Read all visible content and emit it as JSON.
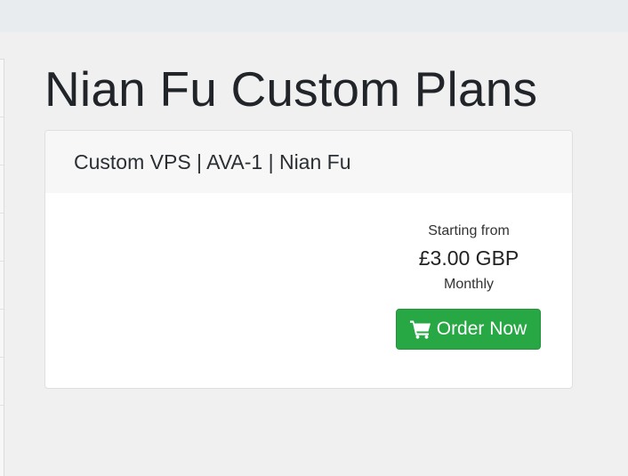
{
  "page": {
    "title": "Nian Fu Custom Plans"
  },
  "product": {
    "name": "Custom VPS | AVA-1 | Nian Fu",
    "pricing": {
      "label": "Starting from",
      "price": "£3.00 GBP",
      "cycle": "Monthly"
    },
    "order_button": {
      "label": "Order Now",
      "icon": "shopping-cart-icon"
    }
  },
  "colors": {
    "accent": "#28a745",
    "background": "#f0f0f0",
    "card_header": "#f7f7f7"
  }
}
